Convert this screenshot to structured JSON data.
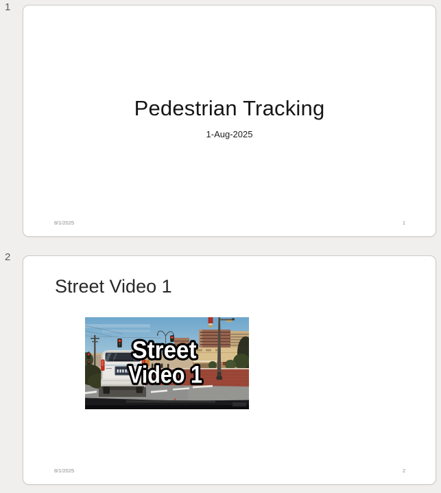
{
  "app": {
    "kind": "slide-preview-pane",
    "background_color": "#f0efed",
    "card_border_color": "#cbcac8"
  },
  "slides": [
    {
      "index_label": "1",
      "title": "Pedestrian Tracking",
      "subtitle": "1-Aug-2025",
      "footer_date": "8/1/2025",
      "slide_number": "1"
    },
    {
      "index_label": "2",
      "title": "Street Video 1",
      "footer_date": "8/1/2025",
      "slide_number": "2",
      "video_thumbnail": {
        "overlay_line1": "Street",
        "overlay_line2": "Video 1",
        "scene": "dashcam view: white SUV at intersection, red traffic lights, brick plaza, tan buildings, street lamp",
        "colors": {
          "sky": "#6ea6cc",
          "brick_plaza": "#9c4839",
          "road": "#8f8f8d",
          "tan_building": "#d9c08c",
          "brown_tower": "#9a6a52",
          "traffic_light_red": "#e83028",
          "dashboard": "#1a1a1d"
        }
      }
    }
  ]
}
